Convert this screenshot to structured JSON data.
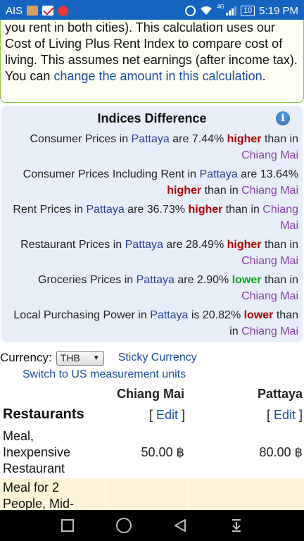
{
  "status_bar": {
    "carrier": "AIS",
    "network": "4G",
    "battery": "10",
    "time": "5:19 PM"
  },
  "intro": {
    "text_before_link": "you rent in both cities). This calculation uses our Cost of Living Plus Rent Index to compare cost of living. This assumes net earnings (after income tax). You can ",
    "link_text": "change the amount in this calculation",
    "text_after_link": "."
  },
  "indices": {
    "title": "Indices Difference",
    "info_icon": "info-icon",
    "rows": [
      {
        "prefix": "Consumer Prices in ",
        "city1": "Pattaya",
        "mid": " are 7.44% ",
        "direction": "higher",
        "suffix": " than in ",
        "city2": "Chiang Mai"
      },
      {
        "prefix": "Consumer Prices Including Rent in ",
        "city1": "Pattaya",
        "mid": " are 13.64% ",
        "direction": "higher",
        "suffix": " than in ",
        "city2": "Chiang Mai"
      },
      {
        "prefix": "Rent Prices in ",
        "city1": "Pattaya",
        "mid": " are 36.73% ",
        "direction": "higher",
        "suffix": " than in ",
        "city2": "Chiang Mai"
      },
      {
        "prefix": "Restaurant Prices in ",
        "city1": "Pattaya",
        "mid": " are 28.49% ",
        "direction": "higher",
        "suffix": " than in ",
        "city2": "Chiang Mai"
      },
      {
        "prefix": "Groceries Prices in ",
        "city1": "Pattaya",
        "mid": " are 2.90% ",
        "direction": "lower",
        "suffix": " than in ",
        "city2": "Chiang Mai"
      },
      {
        "prefix": "Local Purchasing Power in ",
        "city1": "Pattaya",
        "mid": " is 20.82% ",
        "direction": "lower",
        "suffix": " than in ",
        "city2": "Chiang Mai"
      }
    ]
  },
  "currency": {
    "label": "Currency:",
    "selected": "THB",
    "sticky_link": "Sticky Currency",
    "switch_units_link": "Switch to US measurement units"
  },
  "table": {
    "col1": "Chiang Mai",
    "col2": "Pattaya",
    "section_title": "Restaurants",
    "edit_open": "[ ",
    "edit_label": "Edit",
    "edit_close": " ]",
    "rows": [
      {
        "name": "Meal, Inexpensive Restaurant",
        "v1": "50.00 ฿",
        "v2": "80.00 ฿"
      },
      {
        "name": "Meal for 2 People, Mid-",
        "v1": "",
        "v2": ""
      }
    ]
  },
  "nav": {
    "recents": "square-icon",
    "home": "circle-icon",
    "back": "triangle-back-icon",
    "notifications": "pull-down-icon"
  },
  "colors": {
    "status_bar": "#1565c0",
    "link": "#1a4fa0",
    "higher": "#b00000",
    "lower_groceries": "#13a113",
    "indices_bg": "#e7eef8",
    "highlight_row": "#fdf3d8"
  }
}
